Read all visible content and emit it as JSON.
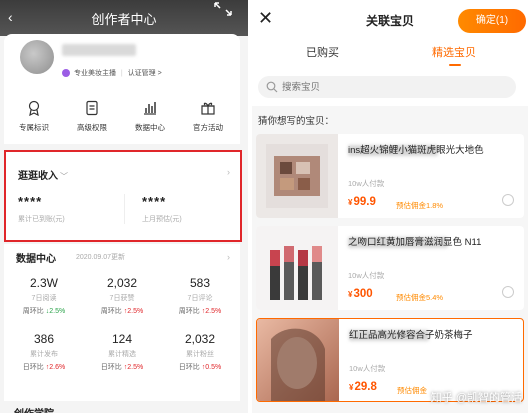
{
  "left": {
    "title": "创作者中心",
    "profile": {
      "badge_label": "专业美妆主播",
      "cert_link": "认证管理 >"
    },
    "tools": [
      {
        "label": "专属标识",
        "icon": "badge-icon"
      },
      {
        "label": "高级权限",
        "icon": "permission-icon"
      },
      {
        "label": "数据中心",
        "icon": "chart-icon"
      },
      {
        "label": "官方活动",
        "icon": "gift-icon"
      }
    ],
    "income": {
      "title": "逛逛收入",
      "chevron": "﹀",
      "items": [
        {
          "value": "****",
          "label": "累计已到账(元)"
        },
        {
          "value": "****",
          "label": "上月预估(元)"
        }
      ]
    },
    "data_center": {
      "title": "数据中心",
      "updated": "2020.09.07更新",
      "metrics": [
        {
          "value": "2.3W",
          "label": "7日阅读",
          "change_prefix": "周环比",
          "arrow": "↓",
          "change": "2.5%",
          "dir": "down"
        },
        {
          "value": "2,032",
          "label": "7日获赞",
          "change_prefix": "周环比",
          "arrow": "↑",
          "change": "2.5%",
          "dir": "up"
        },
        {
          "value": "583",
          "label": "7日评论",
          "change_prefix": "周环比",
          "arrow": "↑",
          "change": "2.5%",
          "dir": "up"
        },
        {
          "value": "386",
          "label": "累计发布",
          "change_prefix": "日环比",
          "arrow": "↑",
          "change": "2.6%",
          "dir": "up"
        },
        {
          "value": "124",
          "label": "累计精选",
          "change_prefix": "日环比",
          "arrow": "↑",
          "change": "2.5%",
          "dir": "up"
        },
        {
          "value": "2,032",
          "label": "累计粉丝",
          "change_prefix": "日环比",
          "arrow": "↑",
          "change": "0.5%",
          "dir": "up"
        }
      ]
    },
    "creation_title": "创作学院"
  },
  "right": {
    "title": "关联宝贝",
    "confirm": "确定(1)",
    "tabs": [
      "已购买",
      "精选宝贝"
    ],
    "active_tab": 1,
    "search_placeholder": "搜索宝贝",
    "guess": "猜你想写的宝贝：",
    "products": [
      {
        "name": "ins超火锦鲤小猫斑虎眼光大地色",
        "sold": "10w人付款",
        "currency": "¥",
        "price": "99.9",
        "commission": "预估佣金1.8%"
      },
      {
        "name": "之吻口红黄加唇膏滋润显色 N11",
        "sold": "10w人付款",
        "currency": "¥",
        "price": "300",
        "commission": "预估佣金5.4%"
      },
      {
        "name": "红正品高光修容合子奶茶梅子",
        "sold": "10w人付款",
        "currency": "¥",
        "price": "29.8",
        "commission": "预估佣金"
      }
    ],
    "watermark": "知乎 @凯智的管活"
  },
  "colors": {
    "accent": "#ff6a00",
    "highlight_border": "#e0262a",
    "price": "#ff5500"
  }
}
